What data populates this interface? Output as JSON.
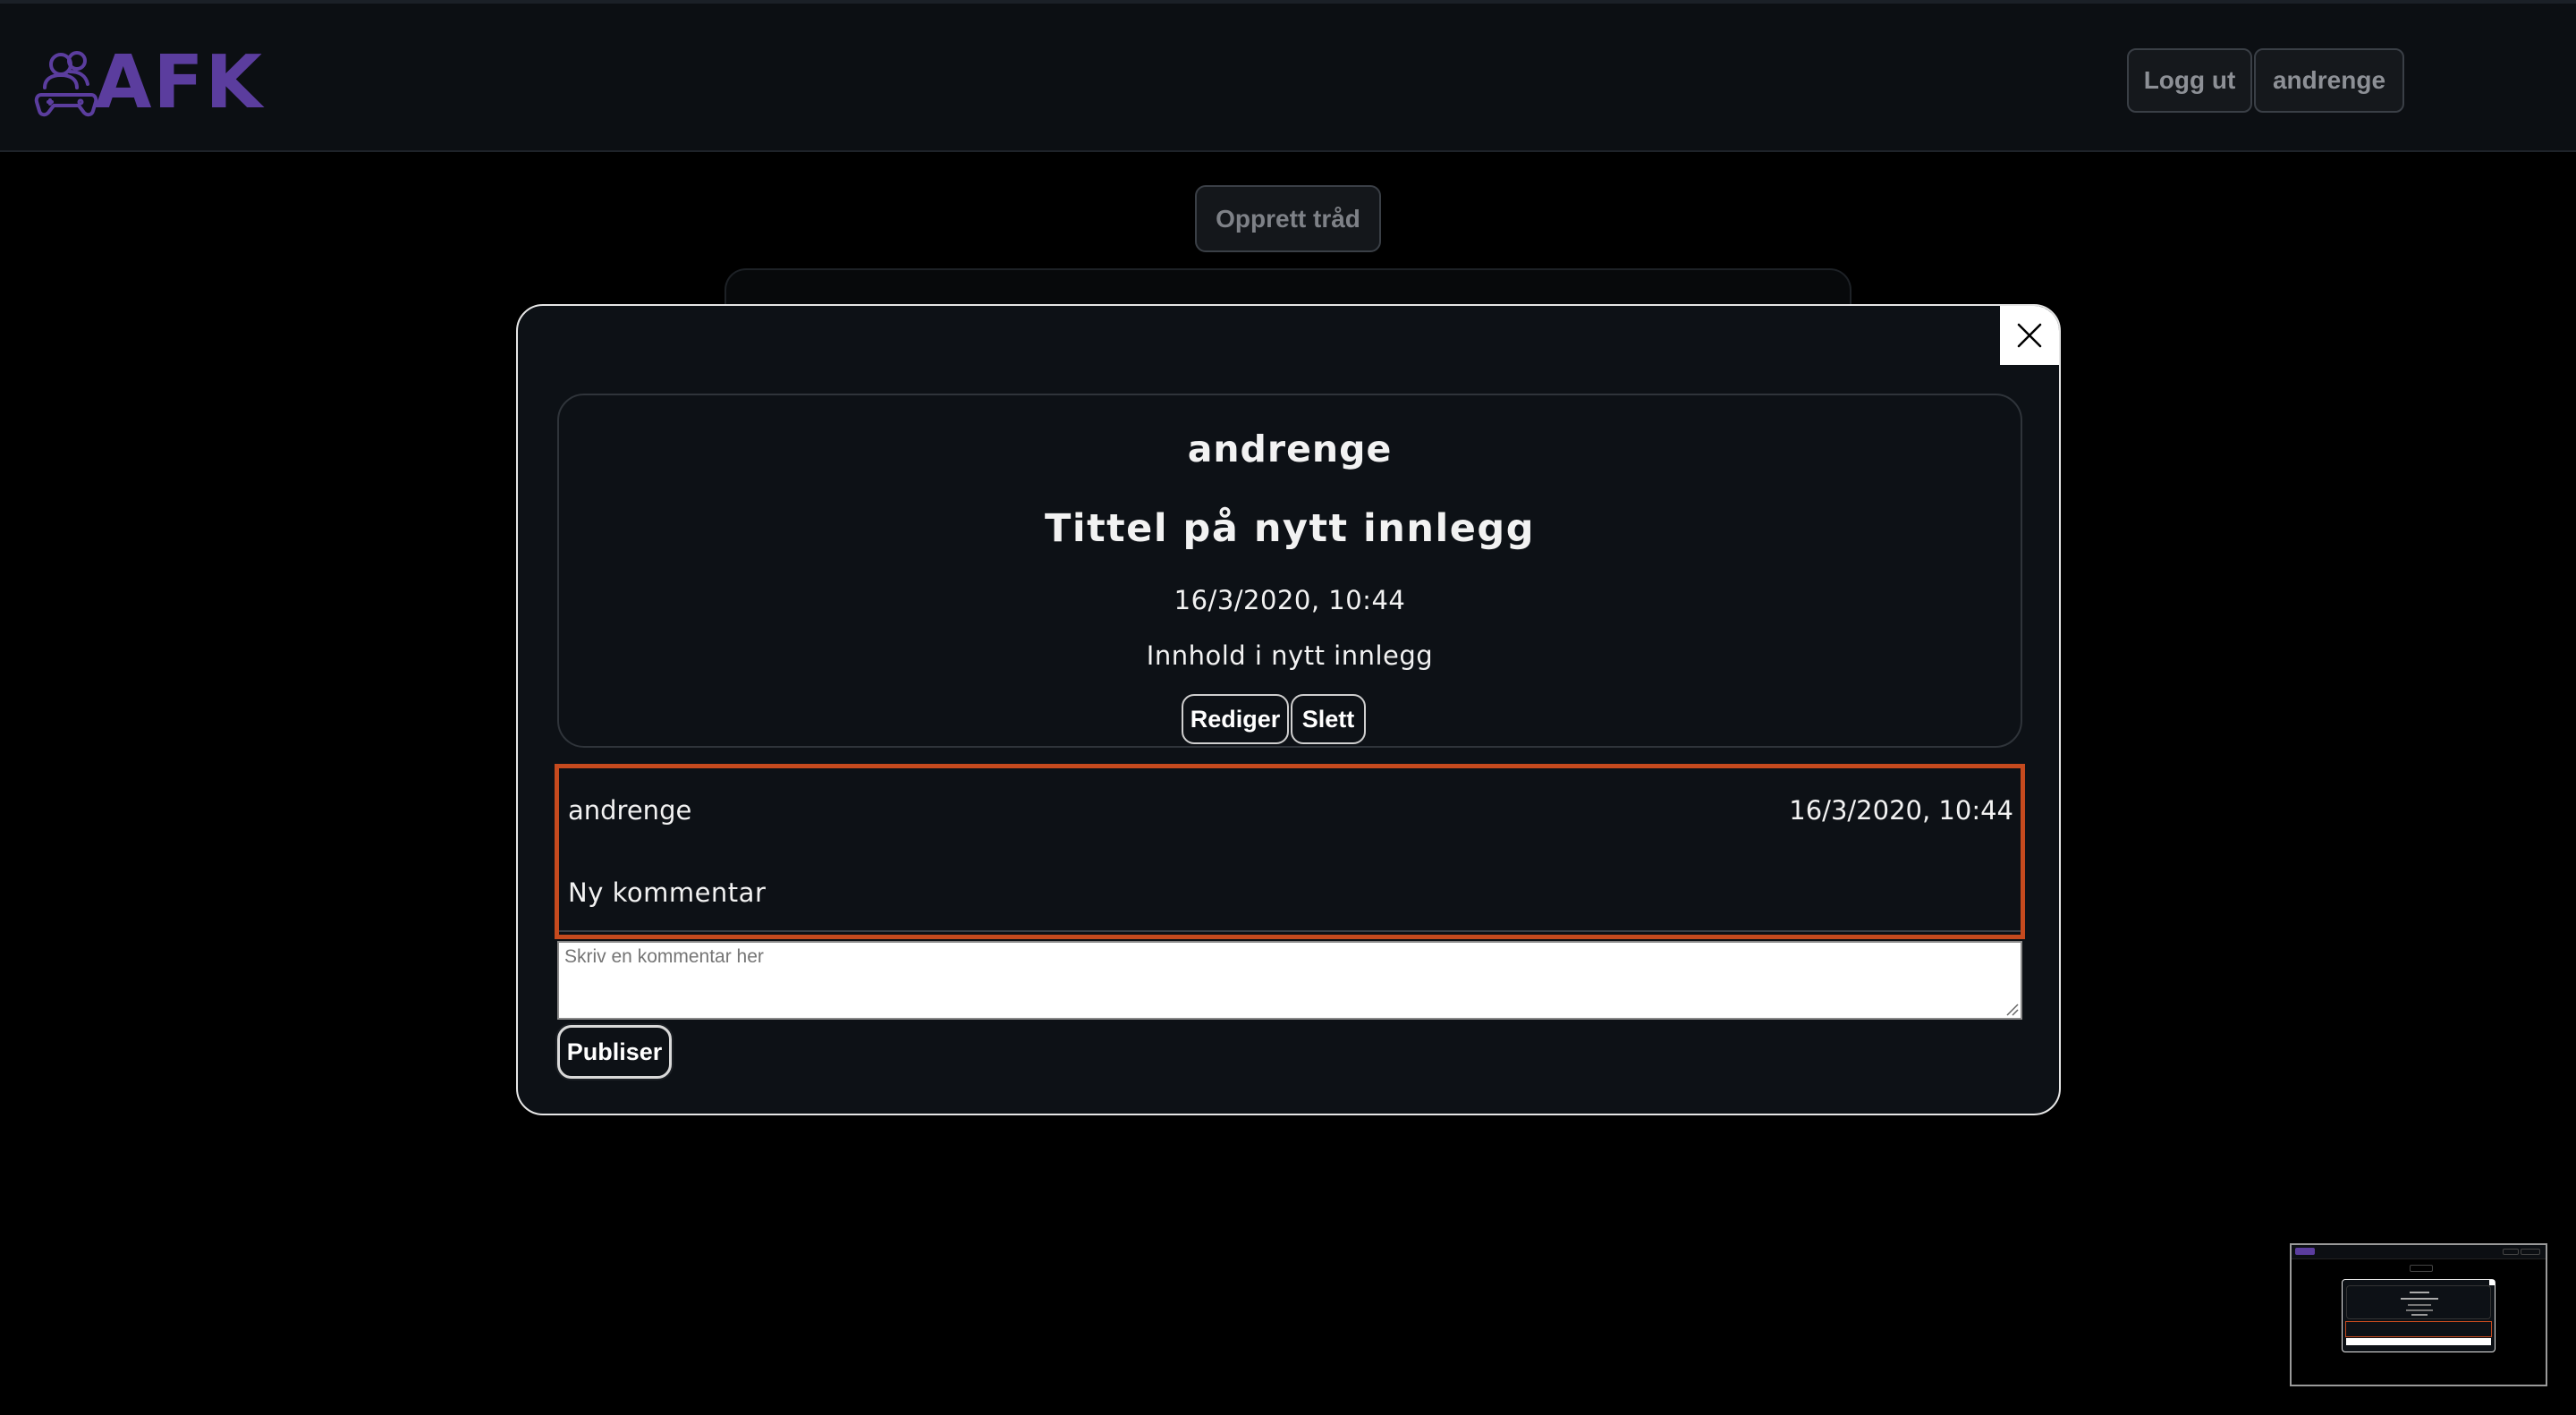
{
  "header": {
    "logo_text": "AFK",
    "logout_label": "Logg ut",
    "username_label": "andrenge"
  },
  "main": {
    "create_thread_label": "Opprett tråd"
  },
  "modal": {
    "close_icon": "close-icon",
    "post": {
      "author": "andrenge",
      "title": "Tittel på nytt innlegg",
      "date": "16/3/2020, 10:44",
      "content": "Innhold i nytt innlegg",
      "edit_label": "Rediger",
      "delete_label": "Slett"
    },
    "comment": {
      "author": "andrenge",
      "date": "16/3/2020, 10:44",
      "text": "Ny kommentar"
    },
    "comment_input": {
      "placeholder": "Skriv en kommentar her",
      "value": ""
    },
    "publish_label": "Publiser"
  },
  "colors": {
    "brand": "#5b3d9e",
    "highlight": "#c54a1e",
    "background": "#000000",
    "panel": "#0d1116"
  }
}
